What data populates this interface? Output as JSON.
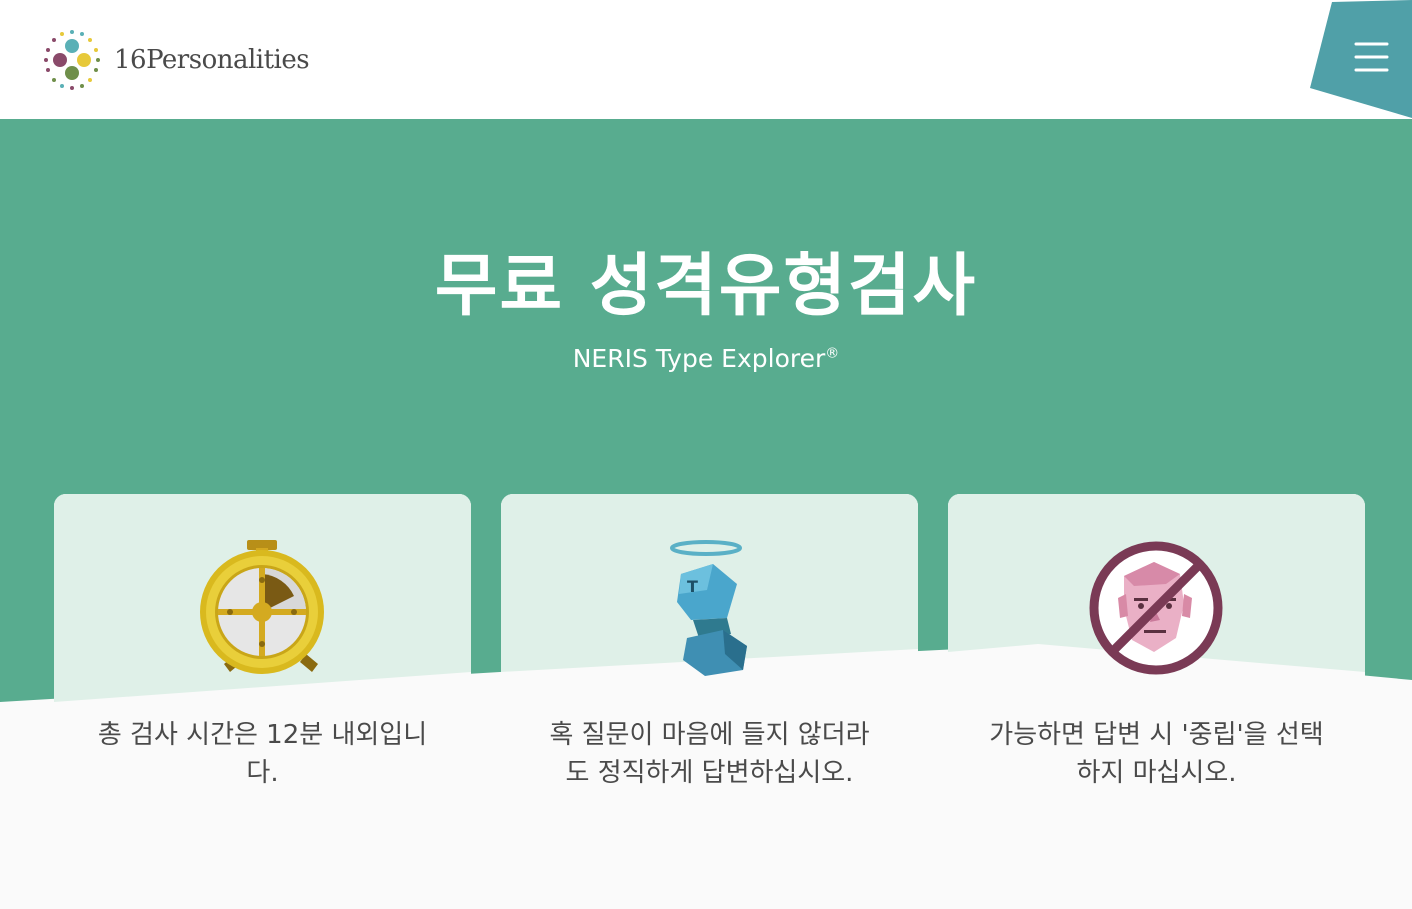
{
  "brand": {
    "name": "16Personalities",
    "colors": {
      "hero_green": "#58ac8f",
      "menu_teal": "#50a0a8",
      "card_top": "#dff0e8",
      "card_bottom": "#fafafa"
    }
  },
  "header": {
    "menu_icon": "hamburger-menu-icon"
  },
  "hero": {
    "title": "무료 성격유형검사",
    "subtitle": "NERIS Type Explorer",
    "subtitle_mark": "®"
  },
  "cards": [
    {
      "icon": "stopwatch-icon",
      "text": "총 검사 시간은 12분 내외입니다."
    },
    {
      "icon": "honest-cube-figure-icon",
      "text": "혹 질문이 마음에 들지 않더라도 정직하게 답변하십시오."
    },
    {
      "icon": "no-neutral-face-icon",
      "text": "가능하면 답변 시 '중립'을 선택하지 마십시오."
    }
  ]
}
